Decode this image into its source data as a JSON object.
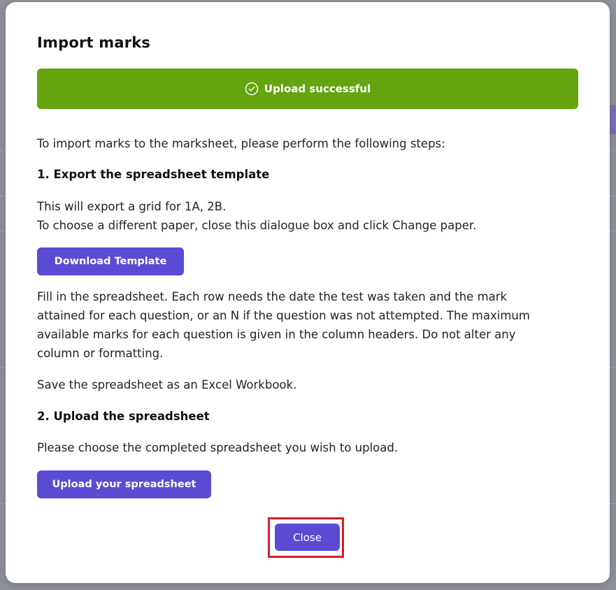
{
  "modal": {
    "title": "Import marks",
    "banner": {
      "text": "Upload successful",
      "icon": "check-circle-icon",
      "color": "#64a40f"
    },
    "intro": "To import marks to the marksheet, please perform the following steps:",
    "step1": {
      "heading": "1. Export the spreadsheet template",
      "line1": "This will export a grid for 1A, 2B.",
      "line2": "To choose a different paper, close this dialogue box and click Change paper.",
      "button_label": "Download Template",
      "instructions": [
        "Fill in the spreadsheet. Each row needs the date the test was taken and the mark",
        "attained for each question, or an N if the question was not attempted. The maximum",
        "available marks for each question is given in the column headers. Do not alter any",
        "column or formatting."
      ],
      "save_note": "Save the spreadsheet as an Excel Workbook."
    },
    "step2": {
      "heading": "2. Upload the spreadsheet",
      "description": "Please choose the completed spreadsheet you wish to upload.",
      "button_label": "Upload your spreadsheet"
    },
    "close_label": "Close"
  },
  "colors": {
    "primary_button": "#5b4bd3",
    "success": "#64a40f",
    "highlight": "#d81b2b",
    "overlay": "#8e9099"
  }
}
